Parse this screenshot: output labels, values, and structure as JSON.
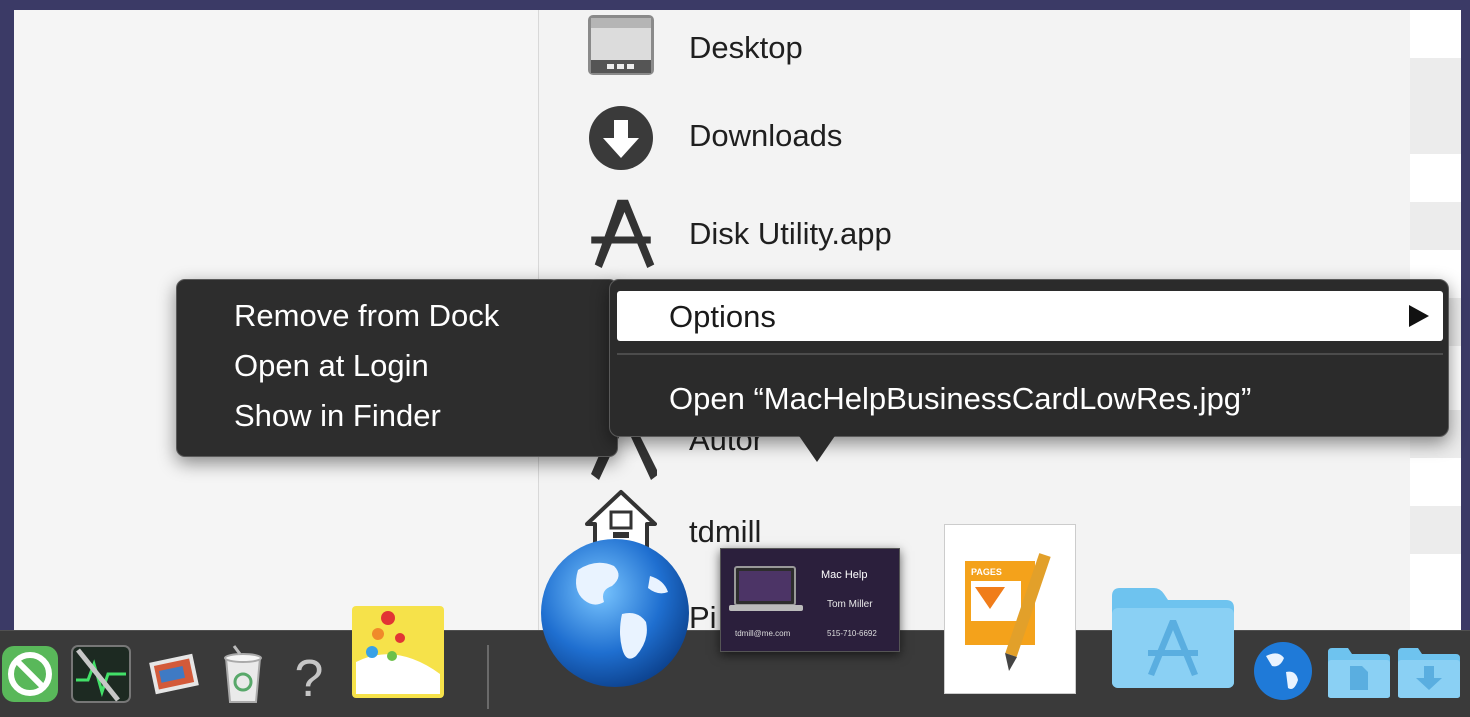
{
  "stack": {
    "items": [
      {
        "label": "Desktop"
      },
      {
        "label": "Downloads"
      },
      {
        "label": "Disk Utility.app"
      },
      {
        "label": "Automator.app",
        "partially_visible": "Autor"
      },
      {
        "label": "tdmill"
      },
      {
        "label": "Pi",
        "partially_visible": "Pi"
      }
    ]
  },
  "dock_context_menu": {
    "items": [
      {
        "label": "Remove from Dock"
      },
      {
        "label": "Open at Login"
      },
      {
        "label": "Show in Finder"
      }
    ]
  },
  "stack_context_menu": {
    "options_label": "Options",
    "open_label": "Open “MacHelpBusinessCardLowRes.jpg”"
  },
  "business_card": {
    "brand": "Mac Help",
    "name": "Tom Miller",
    "email": "tdmill@me.com",
    "phone": "515-710-6692"
  },
  "pages_doc": {
    "label": "PAGES"
  },
  "dock_icons": [
    "do-not-disturb-icon",
    "activity-monitor-icon",
    "photos-icon",
    "trash-icon",
    "question-mark-icon",
    "stickies-app-icon",
    "globe-icon",
    "business-card-image",
    "pages-document-icon",
    "applications-folder-icon",
    "globe-small-icon",
    "documents-folder-icon",
    "downloads-folder-icon"
  ],
  "colors": {
    "desktop": "#3b3a66",
    "menu_bg": "#2b2b2b",
    "menu_highlight": "#ffffff",
    "dock_bg": "#3a3a3a",
    "folder_blue": "#6ec3ef"
  }
}
